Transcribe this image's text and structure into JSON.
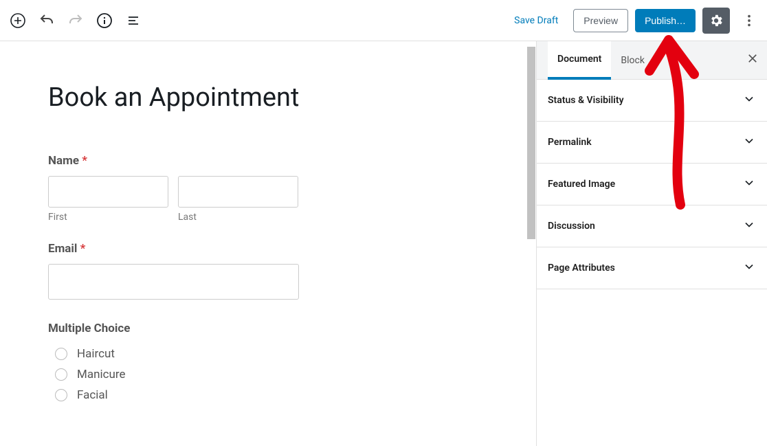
{
  "toolbar": {
    "save_draft": "Save Draft",
    "preview": "Preview",
    "publish": "Publish…"
  },
  "page": {
    "title": "Book an Appointment"
  },
  "form": {
    "name_label": "Name",
    "first_label": "First",
    "last_label": "Last",
    "email_label": "Email",
    "multiple_choice_label": "Multiple Choice",
    "choices": [
      "Haircut",
      "Manicure",
      "Facial"
    ],
    "required_mark": "*"
  },
  "sidebar": {
    "tabs": [
      "Document",
      "Block"
    ],
    "active_tab_index": 0,
    "panels": [
      "Status & Visibility",
      "Permalink",
      "Featured Image",
      "Discussion",
      "Page Attributes"
    ]
  },
  "colors": {
    "primary": "#007cba",
    "required": "#d63638",
    "annotation": "#e3000f"
  }
}
